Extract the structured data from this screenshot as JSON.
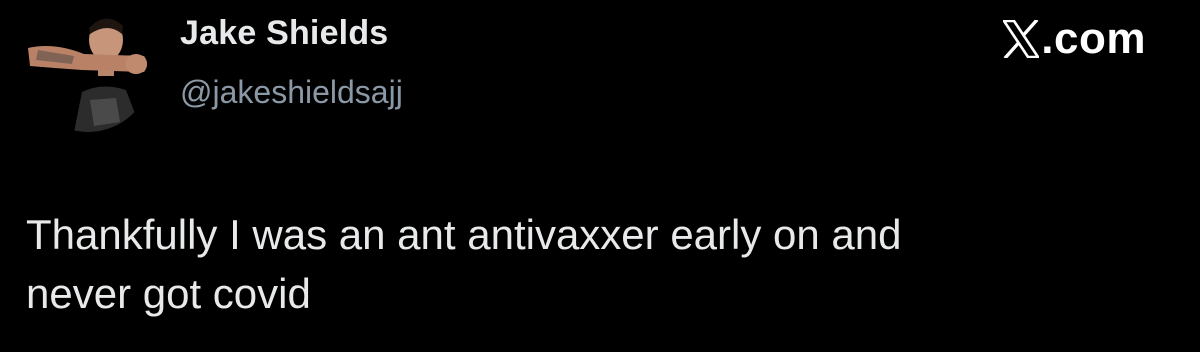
{
  "tweet": {
    "author_name": "Jake Shields",
    "author_handle": "@jakeshieldsajj",
    "platform_label": "X.com",
    "text_line_1": "Thankfully I was an ant antivaxxer early on and",
    "text_line_2": "never got covid"
  },
  "icons": {
    "platform": "x-logo-icon",
    "avatar": "profile-photo"
  },
  "colors": {
    "background": "#000000",
    "primary_text": "#e7e9ea",
    "secondary_text": "#8b98a5"
  }
}
